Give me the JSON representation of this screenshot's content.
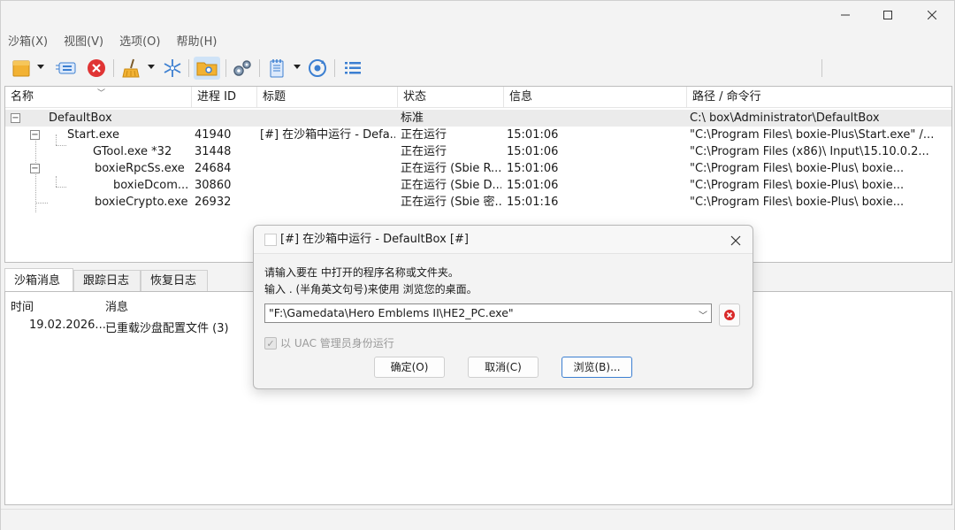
{
  "menu": [
    "沙箱(X)",
    "视图(V)",
    "选项(O)",
    "帮助(H)"
  ],
  "toolbar": {
    "icons": [
      "new-box-icon",
      "sandbox-list-icon",
      "terminate-all-icon",
      "cleanup-icon",
      "freeze-icon",
      "explore-icon",
      "settings-icon",
      "log-icon",
      "refresh-icon",
      "list-view-icon"
    ]
  },
  "tree": {
    "columns": [
      "名称",
      "进程 ID",
      "标题",
      "状态",
      "信息",
      "路径 / 命令行"
    ],
    "rows": [
      {
        "name": "DefaultBox",
        "pid": "",
        "title": "",
        "status": "标准",
        "info": "",
        "path": "C:\\        box\\Administrator\\DefaultBox"
      },
      {
        "name": "Start.exe",
        "pid": "41940",
        "title": "[#] 在沙箱中运行 - Defa...",
        "status": "正在运行",
        "info": "15:01:06",
        "path": "\"C:\\Program Files\\        boxie-Plus\\Start.exe\" /..."
      },
      {
        "name": "GTool.exe *32",
        "pid": "31448",
        "title": "",
        "status": "正在运行",
        "info": "15:01:06",
        "path": "\"C:\\Program Files (x86)\\          Input\\15.10.0.2..."
      },
      {
        "name": "boxieRpcSs.exe",
        "pid": "24684",
        "title": "",
        "status": "正在运行 (Sbie R...",
        "info": "15:01:06",
        "path": "\"C:\\Program Files\\        boxie-Plus\\        boxie..."
      },
      {
        "name": "boxieDcom...",
        "pid": "30860",
        "title": "",
        "status": "正在运行 (Sbie D...",
        "info": "15:01:06",
        "path": "\"C:\\Program Files\\        boxie-Plus\\        boxie..."
      },
      {
        "name": "boxieCrypto.exe",
        "pid": "26932",
        "title": "",
        "status": "正在运行 (Sbie 密...",
        "info": "15:01:16",
        "path": "\"C:\\Program Files\\        boxie-Plus\\        boxie..."
      }
    ]
  },
  "bottom": {
    "tabs": [
      "沙箱消息",
      "跟踪日志",
      "恢复日志"
    ],
    "columns": [
      "时间",
      "消息"
    ],
    "entries": [
      {
        "time": "19.02.2026...",
        "message": "已重载沙盘配置文件 (3)"
      }
    ]
  },
  "dialog": {
    "title": "[#] 在沙箱中运行 - DefaultBox [#]",
    "line1": "请输入要在               中打开的程序名称或文件夹。",
    "line2": "输入 . (半角英文句号)来使用                   浏览您的桌面。",
    "combo_value": "\"F:\\Gamedata\\Hero Emblems II\\HE2_PC.exe\"",
    "checkbox_label": "以 UAC 管理员身份运行",
    "checkbox_checked": true,
    "ok": "确定(O)",
    "cancel": "取消(C)",
    "browse": "浏览(B)..."
  },
  "colors": {
    "accent": "#3c7fd1",
    "stop": "#e03434",
    "folder": "#f2b233"
  }
}
